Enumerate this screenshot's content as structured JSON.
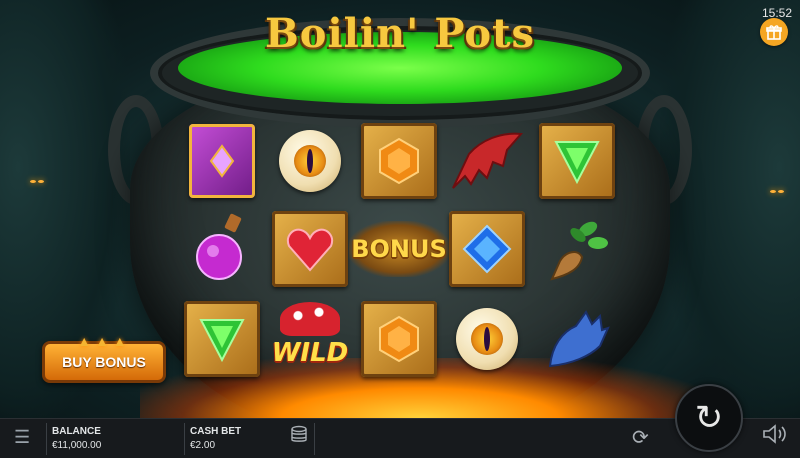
{
  "game": {
    "title": "Boilin' Pots"
  },
  "status": {
    "clock": "15:52"
  },
  "icons": {
    "gift": "gift-icon",
    "menu": "hamburger-menu-icon",
    "coins": "coin-stack-icon",
    "autoplay": "refresh-arrows-icon",
    "spin": "spin-arrow-icon",
    "sound": "speaker-icon"
  },
  "buttons": {
    "buy_bonus": "BUY BONUS"
  },
  "reels": {
    "row1": [
      "purple-spellbook",
      "golden-eyeball",
      "orange-gem",
      "red-bat-wing",
      "green-gem"
    ],
    "row2": [
      "pink-potion",
      "red-heart-gem",
      "bonus",
      "blue-gem",
      "mandrake-root"
    ],
    "row3": [
      "green-gem",
      "wild",
      "orange-gem",
      "golden-eyeball",
      "blue-claw"
    ],
    "bonus_text": "BONUS",
    "wild_text": "WILD"
  },
  "bottom_bar": {
    "balance_label": "BALANCE",
    "balance_value": "€11,000.00",
    "cashbet_label": "CASH BET",
    "cashbet_value": "€2.00"
  },
  "colors": {
    "brew": "#2fdc1e",
    "gold": "#f7c83f",
    "button": "#f5a623"
  }
}
